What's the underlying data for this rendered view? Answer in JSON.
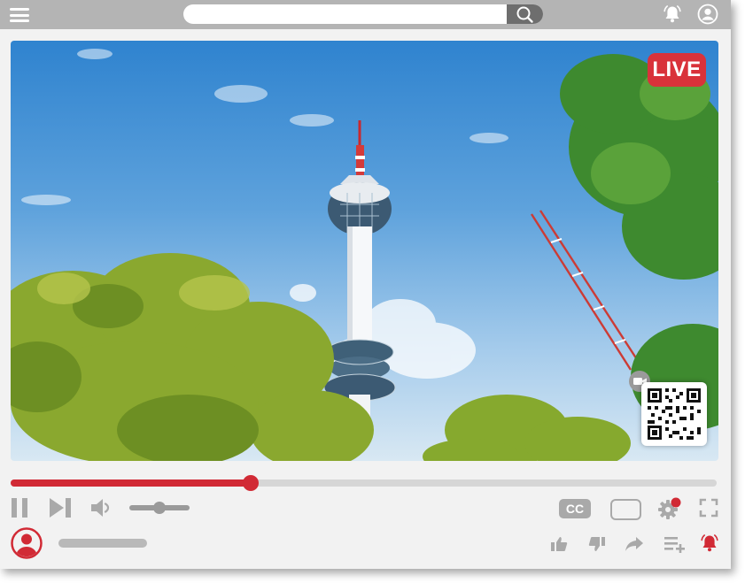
{
  "topbar": {
    "search": {
      "placeholder": "",
      "value": ""
    },
    "icons": [
      "menu-icon",
      "search-icon",
      "notification-bell-icon",
      "account-icon"
    ]
  },
  "video": {
    "live_badge": "LIVE",
    "overlay_icons": [
      "camera-icon",
      "qr-code"
    ]
  },
  "player": {
    "progress_fraction": 0.34,
    "volume_fraction": 0.5,
    "controls": [
      "pause-icon",
      "skip-next-icon",
      "volume-icon",
      "volume-slider",
      "closed-captions",
      "theater-mode-icon",
      "settings-gear-icon",
      "fullscreen-icon"
    ],
    "cc_label": "CC",
    "settings_has_notification": true
  },
  "actions": [
    "like-icon",
    "dislike-icon",
    "share-icon",
    "add-to-playlist-icon",
    "subscribe-bell-icon"
  ],
  "colors": {
    "accent": "#d12a35",
    "live": "#d9323a",
    "topbar": "#b4b4b4",
    "icon_gray": "#a9a9a9",
    "panel": "#f2f2f2"
  }
}
